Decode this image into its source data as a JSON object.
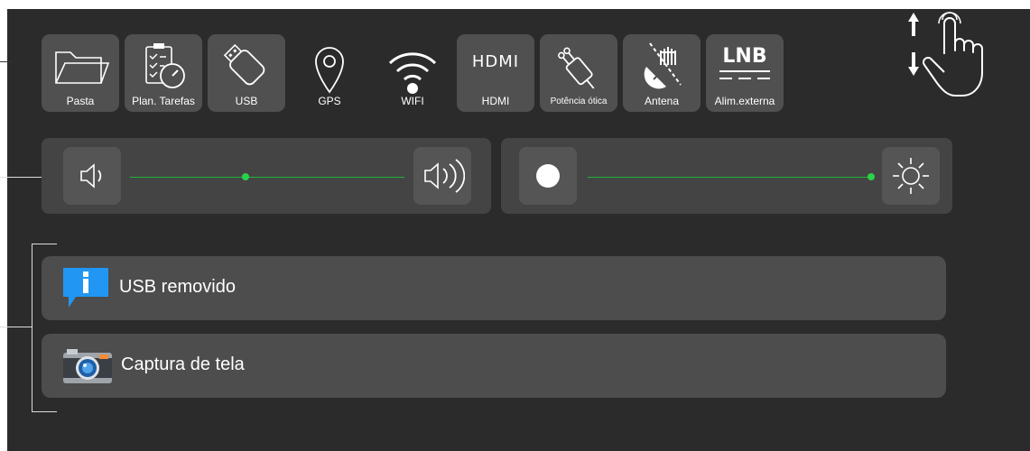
{
  "tiles": [
    {
      "name": "pasta",
      "label": "Pasta",
      "icon": "folder-icon"
    },
    {
      "name": "plan-tarefas",
      "label": "Plan. Tarefas",
      "icon": "task-schedule-icon"
    },
    {
      "name": "usb",
      "label": "USB",
      "icon": "usb-icon"
    },
    {
      "name": "gps",
      "label": "GPS",
      "icon": "gps-pin-icon"
    },
    {
      "name": "wifi",
      "label": "WIFI",
      "icon": "wifi-icon"
    },
    {
      "name": "hdmi",
      "label": "HDMI",
      "icon": "hdmi-icon",
      "logo_text": "HDMI"
    },
    {
      "name": "potencia-otica",
      "label": "Potência ótica",
      "icon": "optical-power-icon"
    },
    {
      "name": "antena",
      "label": "Antena",
      "icon": "antenna-icon"
    },
    {
      "name": "alim-externa",
      "label": "Alim.externa",
      "icon": "lnb-icon",
      "logo_text": "LNB"
    }
  ],
  "gesture": {
    "icon": "swipe-vertical-hand-icon"
  },
  "volume": {
    "left_icon": "volume-low-icon",
    "right_icon": "volume-high-icon",
    "level": 0.42
  },
  "brightness": {
    "left_icon": "brightness-low-icon",
    "right_icon": "brightness-high-icon",
    "level": 1.0
  },
  "notifications": [
    {
      "name": "usb-removed",
      "text": "USB removido",
      "icon": "info-icon"
    },
    {
      "name": "screenshot",
      "text": "Captura de tela",
      "icon": "camera-icon"
    }
  ],
  "colors": {
    "panel": "#2b2b2b",
    "tile": "#505050",
    "track": "#1fb33a",
    "info_blue": "#2196f3"
  }
}
